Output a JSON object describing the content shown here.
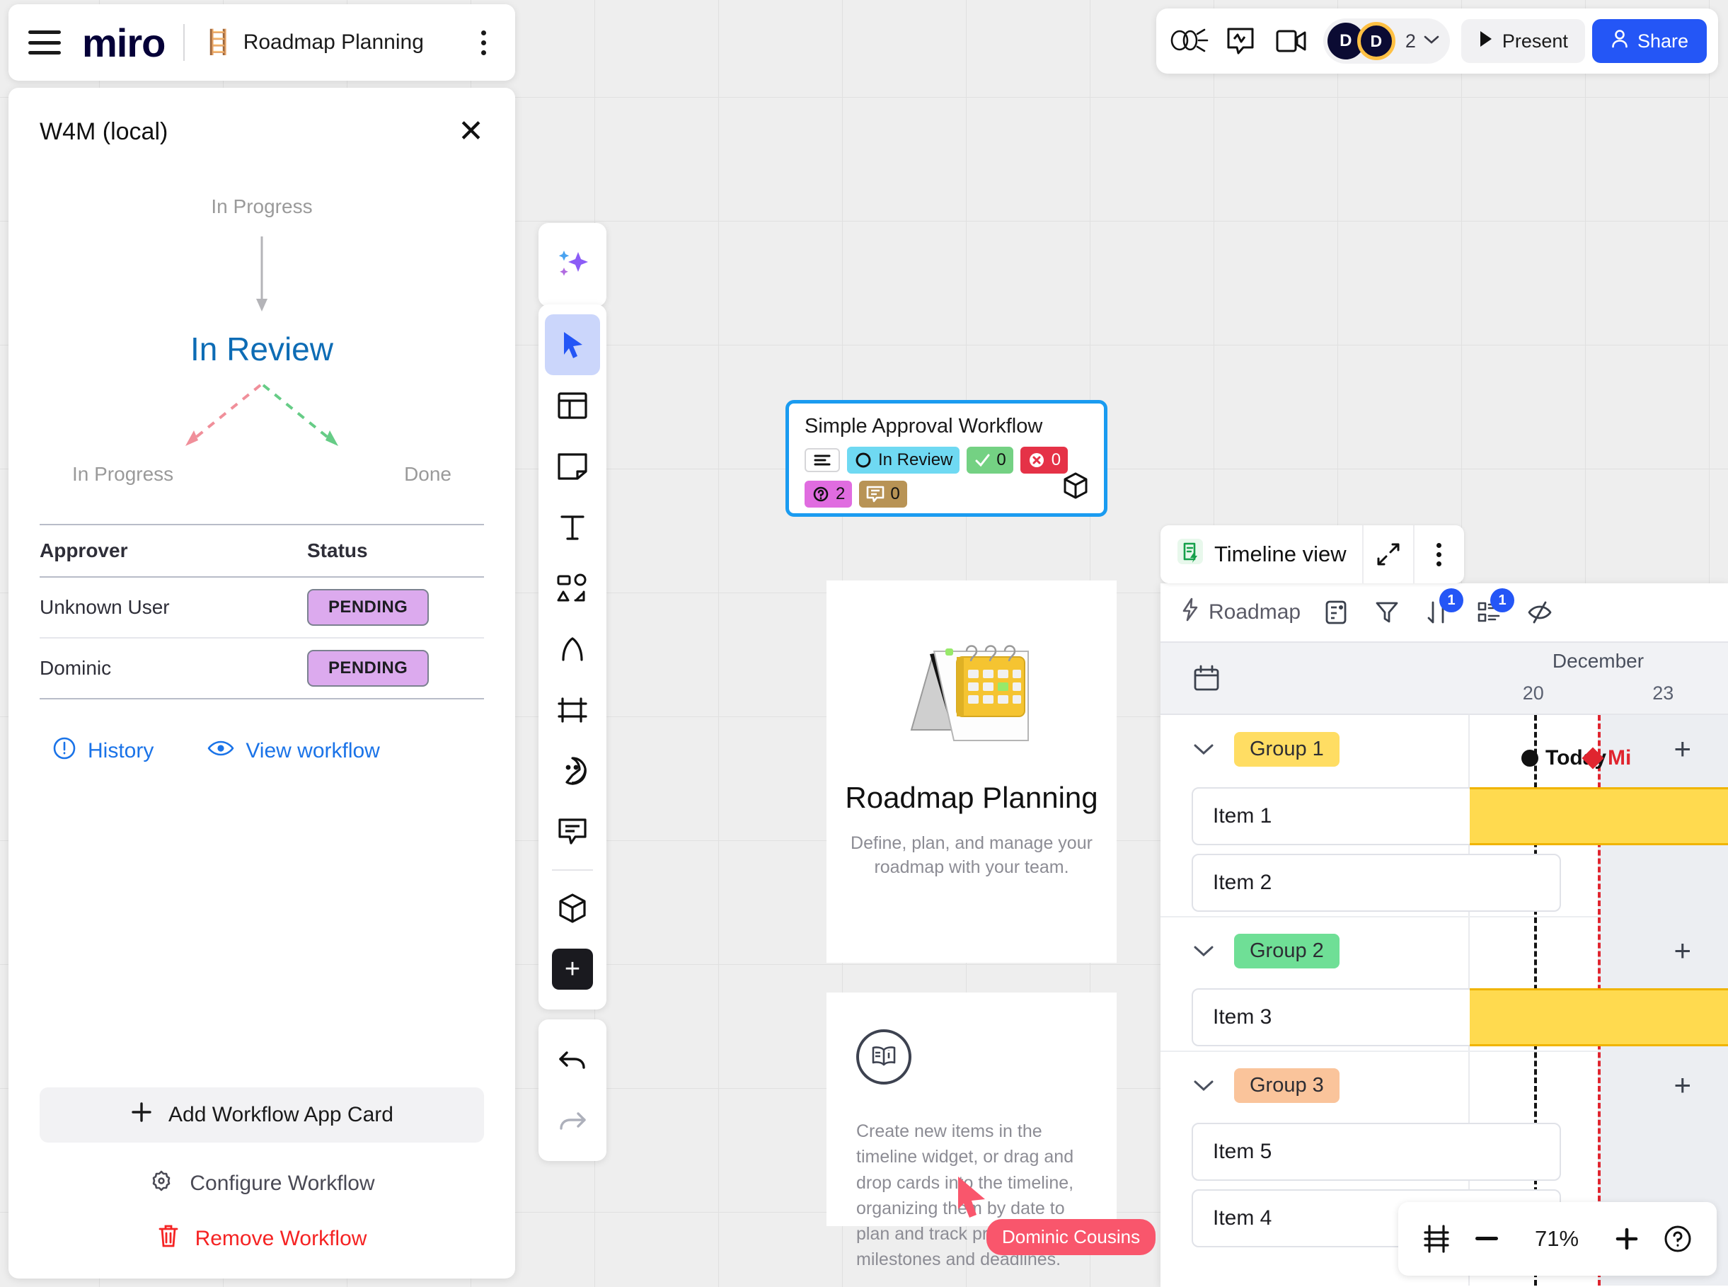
{
  "header": {
    "menu_icon": "hamburger-icon",
    "logo_text": "miro",
    "board_emoji": "🪜",
    "board_title": "Roadmap Planning",
    "kebab_icon": "more-options-icon"
  },
  "topright": {
    "icons": [
      "celebrate-icon",
      "reactions-icon",
      "video-chat-icon"
    ],
    "avatar_1": "D",
    "avatar_2": "D",
    "collaborator_count": "2",
    "chevron": "chevron-down-icon",
    "present_label": "Present",
    "share_label": "Share",
    "share_color": "#2456f6"
  },
  "panel": {
    "title": "W4M (local)",
    "close_icon": "close-icon",
    "workflow": {
      "previous_state": "In Progress",
      "current_state": "In Review",
      "current_state_color": "#0d6cb5",
      "branch_left_label": "In Progress",
      "branch_right_label": "Done",
      "branch_left_color": "#f08f9a",
      "branch_right_color": "#66cc86"
    },
    "approvers_table": {
      "columns": [
        "Approver",
        "Status"
      ],
      "rows": [
        {
          "approver": "Unknown User",
          "status": "PENDING"
        },
        {
          "approver": "Dominic",
          "status": "PENDING"
        }
      ],
      "badge_bg": "#dcaaee"
    },
    "links": [
      {
        "icon": "history-icon",
        "label": "History"
      },
      {
        "icon": "eye-icon",
        "label": "View workflow"
      }
    ],
    "add_card_label": "Add Workflow App Card",
    "configure_label": "Configure Workflow",
    "remove_label": "Remove Workflow",
    "remove_color": "#f52323"
  },
  "toolrail": {
    "ai_icon": "sparkle-ai-icon",
    "tools": [
      "cursor-select-icon",
      "templates-icon",
      "sticky-note-icon",
      "text-icon",
      "shapes-icon",
      "pen-icon",
      "frame-icon",
      "sticker-icon",
      "comment-icon",
      "apps-cube-icon",
      "more-plus-icon"
    ],
    "undo_icon": "undo-icon",
    "redo_icon": "redo-icon"
  },
  "app_card": {
    "title": "Simple Approval Workflow",
    "chips": [
      {
        "name": "description-chip",
        "icon": "description-icon",
        "label": "",
        "bg": "#ffffff"
      },
      {
        "name": "status-chip",
        "icon": "status-circle-icon",
        "label": "In Review",
        "bg": "#6fd9f2"
      },
      {
        "name": "approved-chip",
        "icon": "check-icon",
        "label": "0",
        "bg": "#74d183"
      },
      {
        "name": "rejected-chip",
        "icon": "error-icon",
        "label": "0",
        "bg": "#e53247"
      },
      {
        "name": "pending-chip",
        "icon": "question-icon",
        "label": "2",
        "bg": "#e06ce0"
      },
      {
        "name": "comment-chip",
        "icon": "comment-bubble-icon",
        "label": "0",
        "bg": "#b89355"
      }
    ],
    "cube_icon": "app-cube-icon",
    "border_color": "#1a9bf0"
  },
  "roadmap_card": {
    "illustration": "calendar-illustration",
    "title": "Roadmap Planning",
    "subtitle": "Define, plan, and manage your roadmap with your team."
  },
  "info_card": {
    "icon": "guide-book-icon",
    "text": "Create new items in the timeline widget, or drag and drop cards into the timeline, organizing them by date to plan and track project milestones and deadlines."
  },
  "timeline": {
    "header_label": "Timeline view",
    "header_icon": "timeline-app-icon",
    "expand_icon": "expand-icon",
    "kebab_icon": "more-options-icon",
    "toolbar": {
      "title": "Roadmap",
      "title_icon": "lightning-icon",
      "icons": [
        {
          "name": "card-layout-icon",
          "badge": ""
        },
        {
          "name": "filter-icon",
          "badge": ""
        },
        {
          "name": "sort-icon",
          "badge": "1"
        },
        {
          "name": "group-by-icon",
          "badge": "1"
        },
        {
          "name": "hide-fields-icon",
          "badge": ""
        }
      ]
    },
    "date_header": {
      "calendar_icon": "calendar-icon",
      "month": "December",
      "days": [
        "20",
        "23"
      ]
    },
    "markers": {
      "today_label": "Today",
      "milestone_label": "Mi",
      "today_color": "#111111",
      "milestone_color": "#e0252f"
    },
    "groups": [
      {
        "label": "Group 1",
        "color": "#ffdd63",
        "chevron": "chevron-down-icon",
        "add_icon": "plus-icon",
        "items": [
          {
            "label": "Item 1",
            "has_bar": true
          },
          {
            "label": "Item 2",
            "has_bar": false
          }
        ]
      },
      {
        "label": "Group 2",
        "color": "#6fdf96",
        "chevron": "chevron-down-icon",
        "add_icon": "plus-icon",
        "items": [
          {
            "label": "Item 3",
            "has_bar": true
          }
        ]
      },
      {
        "label": "Group 3",
        "color": "#fac49b",
        "chevron": "chevron-down-icon",
        "add_icon": "plus-icon",
        "items": [
          {
            "label": "Item 5",
            "has_bar": false
          },
          {
            "label": "Item 4",
            "has_bar": false
          }
        ]
      }
    ]
  },
  "zoombar": {
    "fit_icon": "fit-to-screen-icon",
    "minus_label": "−",
    "zoom_level": "71%",
    "plus_label": "+",
    "help_icon": "help-icon"
  },
  "cursor": {
    "name": "Dominic Cousins",
    "color": "#f9566c"
  }
}
